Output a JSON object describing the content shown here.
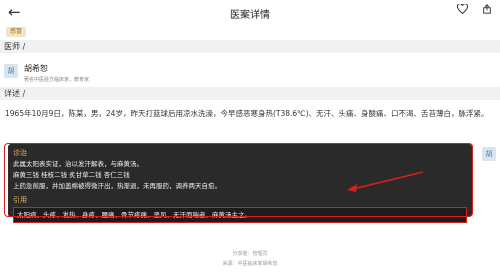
{
  "header": {
    "back_icon": "back-arrow-icon",
    "title": "医案详情",
    "heart_icon": "heart-icon",
    "share_icon": "share-icon"
  },
  "tag": {
    "label": "感冒"
  },
  "sections": {
    "doctor_label": "医师 /",
    "detail_label": "详述 /"
  },
  "author": {
    "avatar_char": "胡",
    "name": "胡希恕",
    "desc": "著名中医经方临床家，教育家"
  },
  "detail": {
    "text": "1965年10月9日，陈某，男，24岁，昨天打篮球后用凉水洗澡，今早感恶寒身热(T38.6℃)、无汗、头痛、身酸痛、口不渴、舌苔薄白，脉浮紧。"
  },
  "diagnosis": {
    "heading": "诊治",
    "lines": [
      "此属太阳表实证，治以发汗解表，与麻黄汤。",
      "麻黄三钱 桂枝二钱 炙甘草二钱 杏仁三钱",
      "上药急煎服，并加盖棉被得微汗出，热渐退，未再服药，调养两天自愈。"
    ],
    "quote_heading": "引用",
    "quote": "太阳病，头疼、发热、身疼、腰痛、骨节疼痛、恶风、无汗而喘者，麻黄汤主之。"
  },
  "right_avatar": {
    "char": "胡"
  },
  "footer": {
    "share": "分享者：管理员",
    "source": "来源：中医临床家胡希恕"
  },
  "colors": {
    "panel_bg": "#2a2a2a",
    "heading_gold": "#e8b764",
    "highlight_red": "#d91e1e",
    "tag_bg": "#f4e4c3"
  }
}
